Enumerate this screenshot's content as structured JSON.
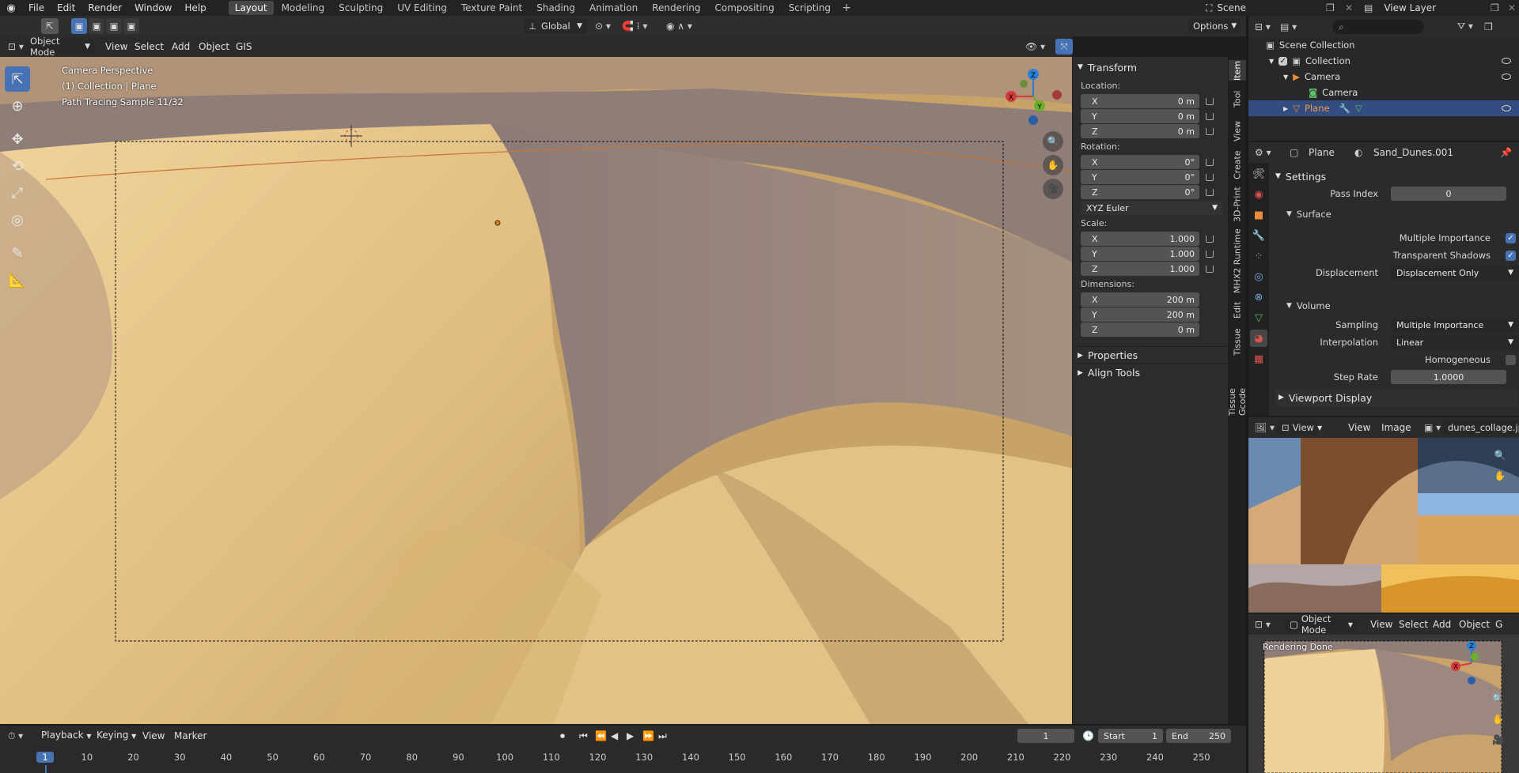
{
  "menu": {
    "file": "File",
    "edit": "Edit",
    "render": "Render",
    "window": "Window",
    "help": "Help"
  },
  "workspaces": [
    "Layout",
    "Modeling",
    "Sculpting",
    "UV Editing",
    "Texture Paint",
    "Shading",
    "Animation",
    "Rendering",
    "Compositing",
    "Scripting"
  ],
  "scene": {
    "name": "Scene",
    "view_layer": "View Layer"
  },
  "viewport_header": {
    "mode": "Object Mode",
    "view": "View",
    "select": "Select",
    "add": "Add",
    "object": "Object",
    "gis": "GIS",
    "orientation": "Global",
    "options": "Options"
  },
  "viewport_overlay": {
    "line1": "Camera Perspective",
    "line2": "(1) Collection | Plane",
    "line3": "Path Tracing Sample 11/32"
  },
  "npanel": {
    "transform_title": "Transform",
    "location_label": "Location:",
    "location": [
      {
        "axis": "X",
        "value": "0 m"
      },
      {
        "axis": "Y",
        "value": "0 m"
      },
      {
        "axis": "Z",
        "value": "0 m"
      }
    ],
    "rotation_label": "Rotation:",
    "rotation": [
      {
        "axis": "X",
        "value": "0°"
      },
      {
        "axis": "Y",
        "value": "0°"
      },
      {
        "axis": "Z",
        "value": "0°"
      }
    ],
    "rotation_mode": "XYZ Euler",
    "scale_label": "Scale:",
    "scale": [
      {
        "axis": "X",
        "value": "1.000"
      },
      {
        "axis": "Y",
        "value": "1.000"
      },
      {
        "axis": "Z",
        "value": "1.000"
      }
    ],
    "dimensions_label": "Dimensions:",
    "dimensions": [
      {
        "axis": "X",
        "value": "200 m"
      },
      {
        "axis": "Y",
        "value": "200 m"
      },
      {
        "axis": "Z",
        "value": "0 m"
      }
    ],
    "properties": "Properties",
    "align_tools": "Align Tools"
  },
  "vtabs": [
    "Item",
    "Tool",
    "View",
    "Create",
    "3D-Print",
    "MHX2 Runtime",
    "Edit",
    "Tissue",
    "Tissue Gcode"
  ],
  "outliner": {
    "scene_collection": "Scene Collection",
    "collection": "Collection",
    "camera_obj": "Camera",
    "camera_data": "Camera",
    "plane": "Plane"
  },
  "properties": {
    "object_name": "Plane",
    "material_name": "Sand_Dunes.001",
    "settings": "Settings",
    "pass_index_label": "Pass Index",
    "pass_index": "0",
    "surface": "Surface",
    "multiple_importance": "Multiple Importance",
    "transparent_shadows": "Transparent Shadows",
    "displacement_label": "Displacement",
    "displacement": "Displacement Only",
    "volume": "Volume",
    "sampling_label": "Sampling",
    "sampling": "Multiple Importance",
    "interpolation_label": "Interpolation",
    "interpolation": "Linear",
    "homogeneous": "Homogeneous",
    "step_rate_label": "Step Rate",
    "step_rate": "1.0000",
    "viewport_display": "Viewport Display"
  },
  "image_editor": {
    "view_dd": "View",
    "view": "View",
    "image": "Image",
    "filename": "dunes_collage.jpg"
  },
  "mini_viewport": {
    "mode": "Object Mode",
    "view": "View",
    "select": "Select",
    "add": "Add",
    "object": "Object",
    "g": "G",
    "status": "Rendering Done"
  },
  "timeline": {
    "playback": "Playback",
    "keying": "Keying",
    "view": "View",
    "marker": "Marker",
    "current_frame": "1",
    "start_label": "Start",
    "start": "1",
    "end_label": "End",
    "end": "250",
    "ticks": [
      "1",
      "10",
      "20",
      "30",
      "40",
      "50",
      "60",
      "70",
      "80",
      "90",
      "100",
      "110",
      "120",
      "130",
      "140",
      "150",
      "160",
      "170",
      "180",
      "190",
      "200",
      "210",
      "220",
      "230",
      "240",
      "250"
    ]
  },
  "colors": {
    "accent": "#4772b3",
    "selection": "#334d80",
    "sand": "#d9b675"
  }
}
